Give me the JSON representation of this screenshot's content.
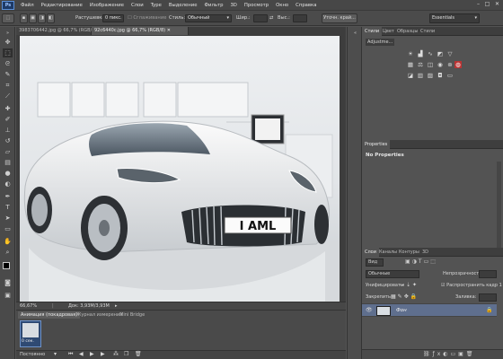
{
  "menu": {
    "logo": "Ps",
    "items": [
      "Файл",
      "Редактирование",
      "Изображение",
      "Слои",
      "Type",
      "Выделение",
      "Фильтр",
      "3D",
      "Просмотр",
      "Окно",
      "Справка"
    ]
  },
  "options": {
    "feather_label": "Растушевка:",
    "feather_value": "0 пикс.",
    "antialias_label": "Сглаживание",
    "style_label": "Стиль:",
    "style_value": "Обычный",
    "width_label": "Шир.:",
    "height_label": "Выс.:",
    "refine_button": "Уточн. край...",
    "workspace": "Essentials"
  },
  "document": {
    "tabs": [
      "3983706442.jpg @ 66,7% (RGB/8)",
      "92c6440c.jpg @ 66,7% (RGB/8)"
    ],
    "plate": "I AML",
    "zoom": "66,67%",
    "doc_info": "Док: 3,93M/3,93M"
  },
  "bottom": {
    "tabs": [
      "Анимация (покадровая)",
      "Журнал измерений",
      "Mini Bridge"
    ],
    "frame_time": "0 сек.",
    "loop": "Постоянно"
  },
  "right": {
    "adjust_tabs": [
      "Стили",
      "Цвет",
      "Образцы",
      "Стили"
    ],
    "adjust_title": "Adjustme...",
    "properties_tab": "Properties",
    "no_properties": "No Properties",
    "layers_tabs": [
      "Слои",
      "Каналы",
      "Контуры",
      "3D"
    ],
    "kind": "Вид",
    "blend_mode": "Обычные",
    "opacity_label": "Непрозрачность:",
    "lock_label": "Закрепить:",
    "fill_label": "Заливка:",
    "unify_label": "Унифицировать:",
    "propagate_label": "Распространить кадр 1",
    "layer_name": "Фон"
  }
}
